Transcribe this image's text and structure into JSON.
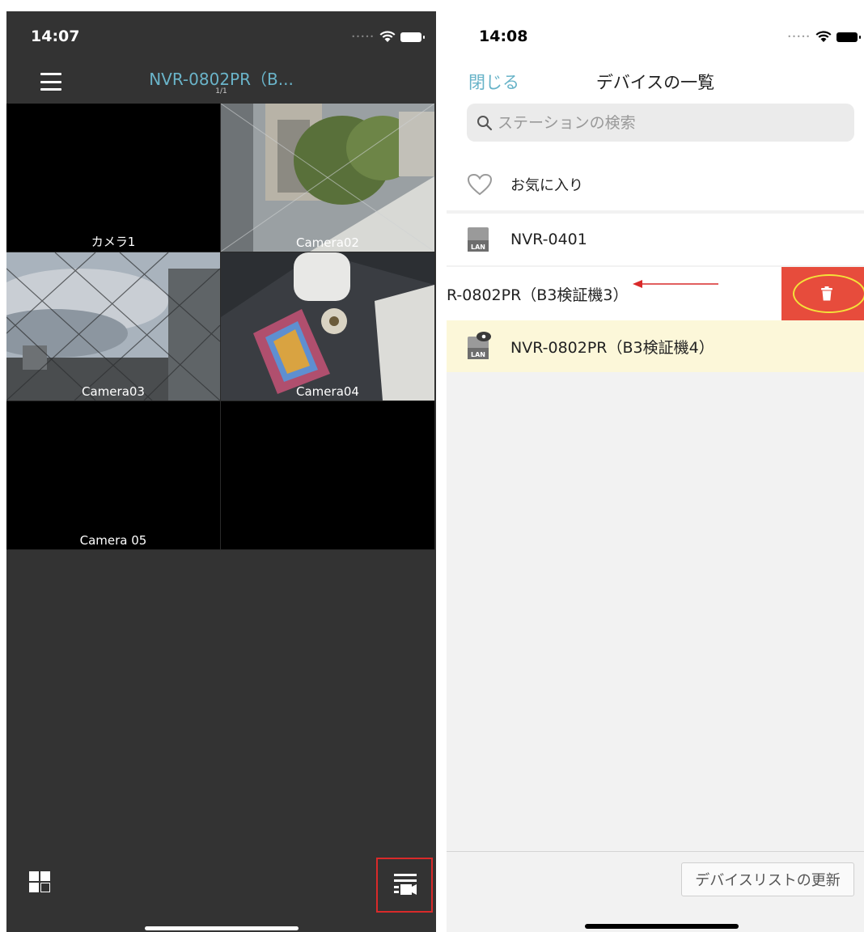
{
  "left_screen": {
    "status": {
      "time": "14:07"
    },
    "nav": {
      "title": "NVR-0802PR（B...",
      "page_indicator": "1/1"
    },
    "cameras": [
      {
        "label": "カメラ1"
      },
      {
        "label": "Camera02"
      },
      {
        "label": "Camera03"
      },
      {
        "label": "Camera04"
      },
      {
        "label": "Camera 05"
      },
      {
        "label": ""
      }
    ]
  },
  "right_screen": {
    "status": {
      "time": "14:08"
    },
    "header": {
      "close_label": "閉じる",
      "title": "デバイスの一覧",
      "search_placeholder": "ステーションの検索"
    },
    "rows": {
      "favorites": "お気に入り",
      "device_0401": "NVR-0401",
      "device_swiped": "R-0802PR（B3検証機3）",
      "device_b4": "NVR-0802PR（B3検証機4）"
    },
    "icons": {
      "lan_badge": "LAN",
      "delete": "trash-icon",
      "heart": "heart-icon"
    },
    "footer": {
      "refresh_label": "デバイスリストの更新"
    },
    "colors": {
      "accent": "#67b3c8",
      "delete": "#e74c3c",
      "highlight_row": "#fcf7d9",
      "annotation_red": "#d92a2a",
      "annotation_yellow": "#f4e23a"
    }
  }
}
